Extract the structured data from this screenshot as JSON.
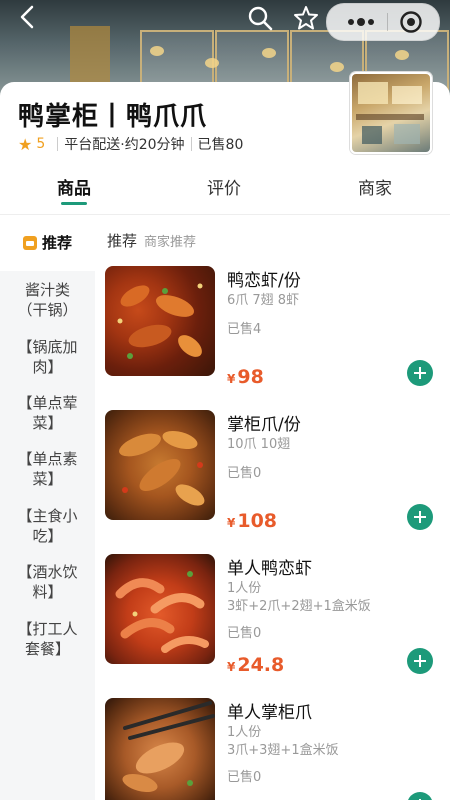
{
  "store": {
    "name": "鸭掌柜丨鸭爪爪",
    "rating": "5",
    "delivery": "平台配送·约20分钟",
    "sold": "已售80"
  },
  "tabs": [
    {
      "label": "商品",
      "active": true
    },
    {
      "label": "评价",
      "active": false
    },
    {
      "label": "商家",
      "active": false
    }
  ],
  "sidebar": {
    "items": [
      {
        "label": "推荐",
        "active": true
      },
      {
        "label": "酱汁类（干锅）"
      },
      {
        "label": "【锅底加肉】"
      },
      {
        "label": "【单点荤菜】"
      },
      {
        "label": "【单点素菜】"
      },
      {
        "label": "【主食小吃】"
      },
      {
        "label": "【酒水饮料】"
      },
      {
        "label": "【打工人套餐】"
      }
    ]
  },
  "section": {
    "title": "推荐",
    "subtitle": "商家推荐"
  },
  "products": [
    {
      "name": "鸭恋虾/份",
      "spec": [
        "6爪 7翅 8虾"
      ],
      "sold": "已售4",
      "currency": "¥",
      "price": "98"
    },
    {
      "name": "掌柜爪/份",
      "spec": [
        "10爪 10翅"
      ],
      "sold": "已售0",
      "currency": "¥",
      "price": "108"
    },
    {
      "name": "单人鸭恋虾",
      "spec": [
        "1人份",
        "3虾+2爪+2翅+1盒米饭"
      ],
      "sold": "已售0",
      "currency": "¥",
      "price": "24.8"
    },
    {
      "name": "单人掌柜爪",
      "spec": [
        "1人份",
        "3爪+3翅+1盒米饭"
      ],
      "sold": "已售0",
      "currency": "¥",
      "price": ""
    }
  ],
  "colors": {
    "accent": "#1d9a7a",
    "price": "#e85b2b",
    "rating": "#f0a020"
  },
  "icons": [
    "back-icon",
    "search-icon",
    "star-icon",
    "more-icon",
    "target-icon",
    "add-icon"
  ]
}
